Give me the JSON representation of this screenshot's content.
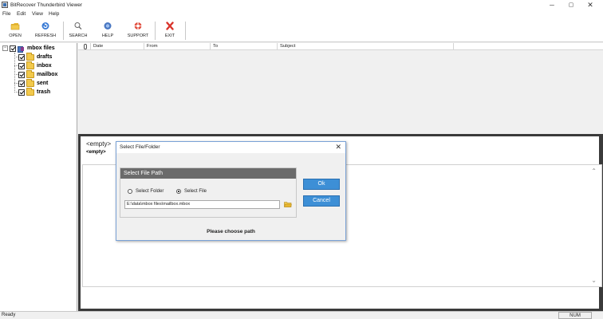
{
  "window": {
    "title": "BitRecover Thunderbird Viewer",
    "min": "─",
    "max": "▢",
    "close": "✕"
  },
  "menu": [
    "File",
    "Edit",
    "View",
    "Help"
  ],
  "toolbar": {
    "open": "OPEN",
    "refresh": "REFRESH",
    "search": "SEARCH",
    "help": "HELP",
    "support": "SUPPORT",
    "exit": "EXIT"
  },
  "tree": {
    "root": "mbox files",
    "items": [
      "drafts",
      "inbox",
      "mailbox",
      "sent",
      "trash"
    ]
  },
  "list": {
    "columns": [
      "Date",
      "From",
      "To",
      "Subject"
    ]
  },
  "preview": {
    "empty_big": "<empty>",
    "empty_small": "<empty>"
  },
  "dialog": {
    "title": "Select File/Folder",
    "close": "✕",
    "group_title": "Select File Path",
    "option_folder": "Select Folder",
    "option_file": "Select File",
    "selected_option": "Select File",
    "path_value": "E:\\data\\mbox files\\mailbox.mbox",
    "ok": "Ok",
    "cancel": "Cancel",
    "message": "Please choose path"
  },
  "status": {
    "text": "Ready",
    "num": "NUM"
  },
  "colors": {
    "button_blue": "#3d8fd6",
    "group_header": "#6b6b6b",
    "folder_yellow": "#f2c94c",
    "exit_red": "#d9342b"
  }
}
